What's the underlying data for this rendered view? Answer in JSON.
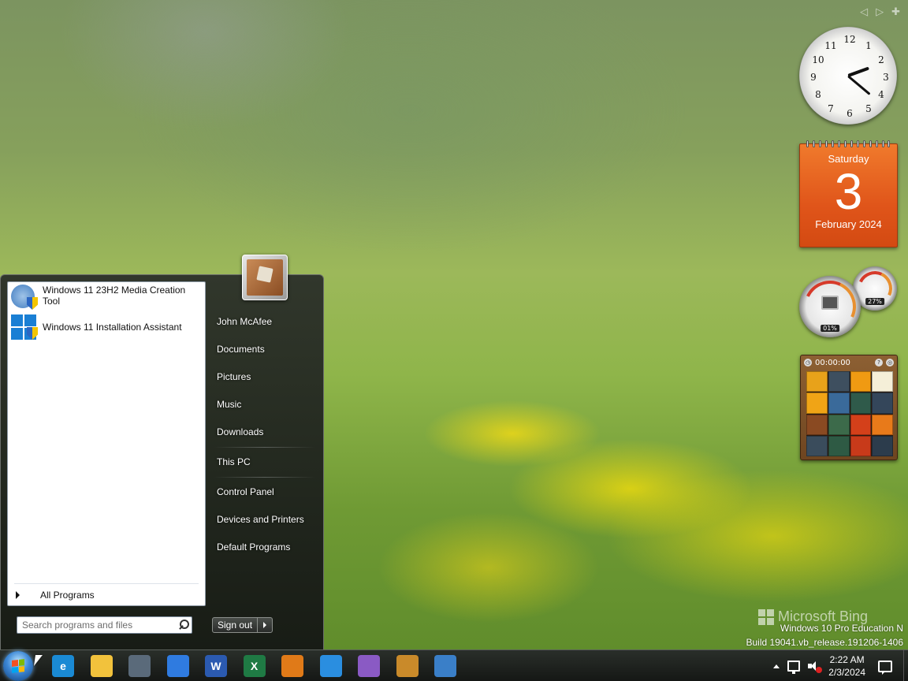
{
  "gadgets": {
    "controls": [
      "◁",
      "▷",
      "✚"
    ],
    "clock": {
      "numbers": [
        "12",
        "1",
        "2",
        "3",
        "4",
        "5",
        "6",
        "7",
        "8",
        "9",
        "10",
        "11"
      ],
      "time": "2:22"
    },
    "calendar": {
      "day_name": "Saturday",
      "date": "3",
      "month_year": "February 2024",
      "accent": "#e8611f"
    },
    "cpu_meter": {
      "cpu_value": "01%",
      "memory_value": "27%"
    },
    "puzzle": {
      "timer": "00:00:00"
    }
  },
  "watermark": {
    "brand": "Microsoft Bing",
    "edition": "Windows 10 Pro Education N",
    "build": "Build 19041.vb_release.191206-1406"
  },
  "start_menu": {
    "programs": [
      {
        "label": "Windows 11 23H2 Media Creation Tool",
        "icon": "media-creation-icon"
      },
      {
        "label": "Windows 11 Installation Assistant",
        "icon": "windows11-icon"
      }
    ],
    "all_programs_label": "All Programs",
    "search_placeholder": "Search programs and files",
    "right_pane": {
      "group1": [
        "John McAfee",
        "Documents",
        "Pictures",
        "Music",
        "Downloads"
      ],
      "group2": [
        "This PC"
      ],
      "group3": [
        "Control Panel",
        "Devices and Printers",
        "Default Programs"
      ]
    },
    "sign_out_label": "Sign out"
  },
  "taskbar": {
    "pinned": [
      {
        "name": "edge",
        "glyph": "e",
        "color": "#1a8ad4"
      },
      {
        "name": "file-explorer",
        "glyph": "",
        "color": "#f2c23c"
      },
      {
        "name": "steam",
        "glyph": "",
        "color": "#5a6a7a"
      },
      {
        "name": "chrome",
        "glyph": "",
        "color": "#2f7be0"
      },
      {
        "name": "word",
        "glyph": "W",
        "color": "#2b5ab0"
      },
      {
        "name": "excel",
        "glyph": "X",
        "color": "#1f7a44"
      },
      {
        "name": "search-tool",
        "glyph": "",
        "color": "#e07a18"
      },
      {
        "name": "vscode",
        "glyph": "",
        "color": "#2a8ee0"
      },
      {
        "name": "visual-studio",
        "glyph": "",
        "color": "#8a5ac4"
      },
      {
        "name": "app-tile",
        "glyph": "",
        "color": "#c98a2a"
      },
      {
        "name": "remote-desktop",
        "glyph": "",
        "color": "#3a7fc8"
      }
    ],
    "tray": {
      "time": "2:22 AM",
      "date": "2/3/2024"
    }
  }
}
